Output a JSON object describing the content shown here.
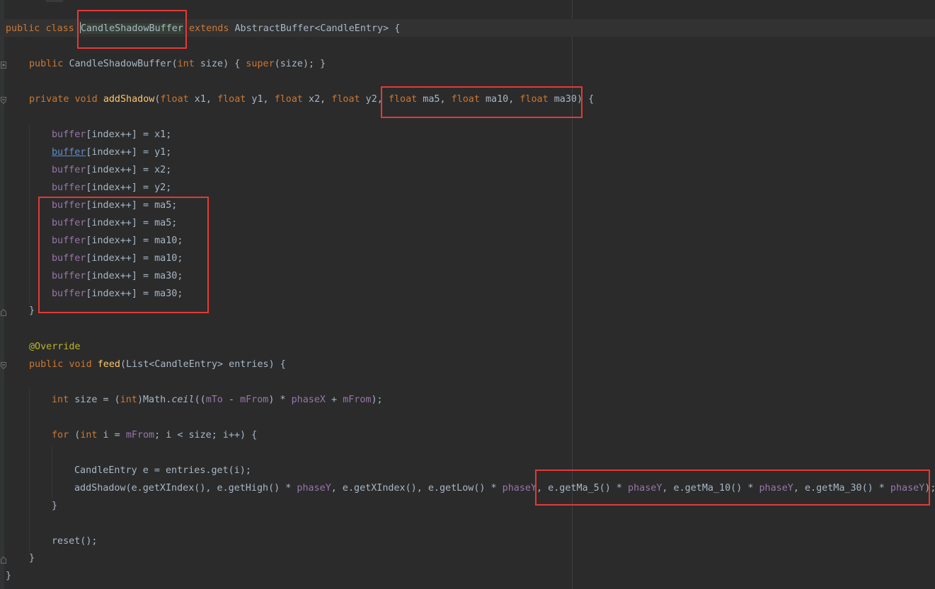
{
  "editor": {
    "colors": {
      "background": "#2b2b2b",
      "keyword": "#cc7832",
      "method_decl": "#ffc66d",
      "field": "#9876aa",
      "default_text": "#a9b7c6",
      "annotation": "#bbb529",
      "highlight_box": "#e53935"
    },
    "tokens": {
      "public": "public",
      "class": "class",
      "extends": "extends",
      "private": "private",
      "void": "void",
      "float": "float",
      "int": "int",
      "for": "for",
      "super": "super",
      "class_name": "CandleShadowBuffer",
      "parent_class": "AbstractBuffer",
      "generic_type": "CandleEntry",
      "method_add_shadow": "addShadow",
      "method_feed": "feed",
      "annotation": "@Override",
      "buffer": "buffer",
      "index": "index",
      "mFrom": "mFrom",
      "mTo": "mTo",
      "phaseX": "phaseX",
      "phaseY": "phaseY",
      "ceil": "ceil"
    },
    "text": {
      "class_open": "<CandleEntry> {",
      "ctor_params": "(",
      "ctor_size_param": " size) ",
      "ctor_brace_open": "{ ",
      "ctor_super_args": "(size);",
      "ctor_brace_close": " }",
      "add_shadow_params_start": "(",
      "p_x1": " x1, ",
      "p_y1": " y1, ",
      "p_x2": " x2, ",
      "p_y2": " y2, ",
      "p_ma5": " ma5, ",
      "p_ma10": " ma10, ",
      "p_ma30": " ma30)",
      "open_brace": " {",
      "assign_x1": "[index++] = x1;",
      "assign_y1": "[index++] = y1;",
      "assign_x2": "[index++] = x2;",
      "assign_y2": "[index++] = y2;",
      "assign_ma5": "[index++] = ma5;",
      "assign_ma10": "[index++] = ma10;",
      "assign_ma30": "[index++] = ma30;",
      "close_brace": "}",
      "feed_params": "(List<CandleEntry> entries) {",
      "size_decl_a": " size = (",
      "size_decl_b": ")Math.",
      "size_decl_c": "((",
      "size_decl_d": " - ",
      "size_decl_e": ") * ",
      "size_decl_f": " + ",
      "size_decl_g": ");",
      "for_a": " (",
      "for_b": " i = ",
      "for_c": "; i < size; i++) {",
      "entry_decl": "CandleEntry e = entries.get(i);",
      "call_a": "addShadow(e.getXIndex(), e.getHigh() * ",
      "call_b": ", e.getXIndex(), e.getLow() * ",
      "call_c": ", e.getMa_5() * ",
      "call_d": ", e.getMa_10() * ",
      "call_e": ", e.getMa_30() * ",
      "call_f": ");",
      "reset_call": "reset();"
    }
  }
}
